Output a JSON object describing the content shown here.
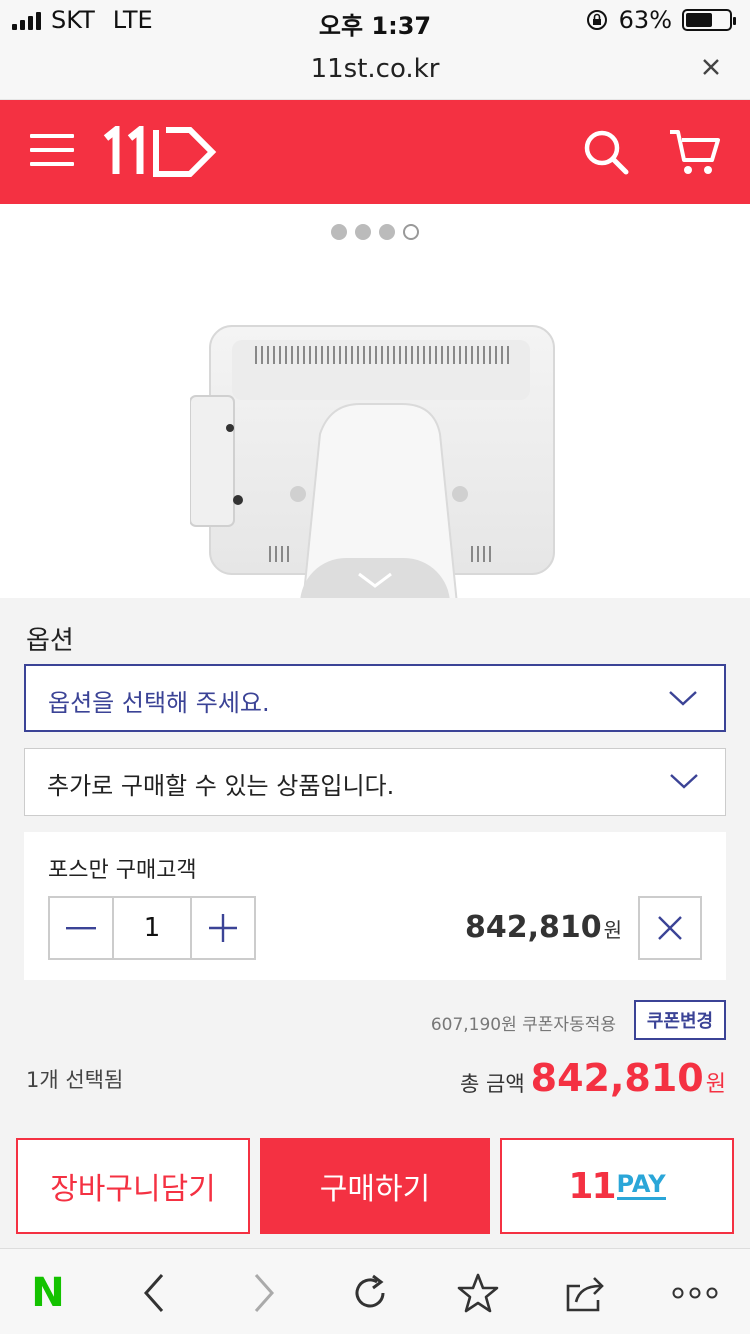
{
  "status_bar": {
    "carrier": "SKT",
    "network": "LTE",
    "time": "오후 1:37",
    "battery": "63%",
    "battery_level": 0.63
  },
  "browser": {
    "url": "11st.co.kr"
  },
  "header": {
    "logo": "11",
    "brand_color": "#f43142"
  },
  "gallery": {
    "dots": 4,
    "active_dot": 3
  },
  "options": {
    "title": "옵션",
    "select_option_placeholder": "옵션을 선택해 주세요.",
    "additional_products_placeholder": "추가로 구매할 수 있는 상품입니다."
  },
  "selected_item": {
    "name": "포스만 구매고객",
    "quantity": "1",
    "price": "842,810",
    "price_unit": "원"
  },
  "coupon": {
    "note": "607,190원 쿠폰자동적용",
    "button": "쿠폰변경"
  },
  "summary": {
    "selected_count": "1개 선택됨",
    "total_label": "총 금액",
    "total_amount": "842,810",
    "total_unit": "원"
  },
  "actions": {
    "cart": "장바구니담기",
    "buy": "구매하기",
    "pay_number": "11",
    "pay_text": "PAY"
  },
  "toolbar": {
    "naver": "N"
  }
}
